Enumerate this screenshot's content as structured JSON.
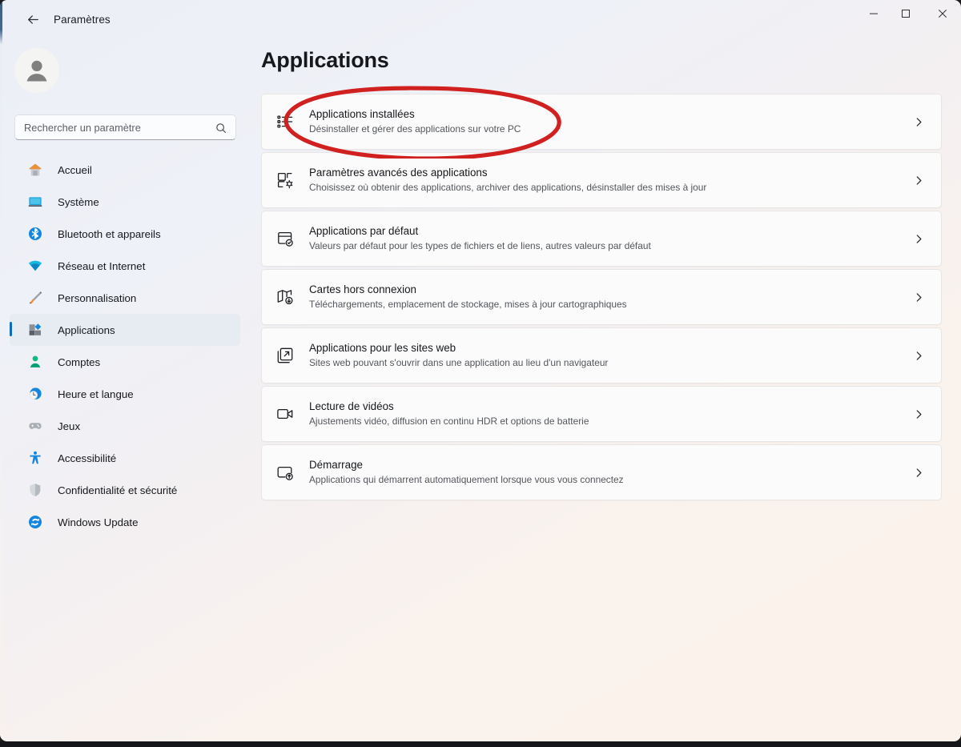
{
  "window": {
    "title": "Paramètres",
    "back_icon": "back-arrow-icon",
    "minimize_label": "—",
    "maximize_label": "□",
    "close_label": "✕"
  },
  "sidebar": {
    "avatar_icon": "user-avatar-icon",
    "search": {
      "placeholder": "Rechercher un paramètre",
      "value": "",
      "icon": "search-icon"
    },
    "items": [
      {
        "label": "Accueil",
        "icon": "home-icon",
        "selected": false
      },
      {
        "label": "Système",
        "icon": "system-icon",
        "selected": false
      },
      {
        "label": "Bluetooth et appareils",
        "icon": "bluetooth-icon",
        "selected": false
      },
      {
        "label": "Réseau et Internet",
        "icon": "network-icon",
        "selected": false
      },
      {
        "label": "Personnalisation",
        "icon": "brush-icon",
        "selected": false
      },
      {
        "label": "Applications",
        "icon": "apps-icon",
        "selected": true
      },
      {
        "label": "Comptes",
        "icon": "accounts-icon",
        "selected": false
      },
      {
        "label": "Heure et langue",
        "icon": "clock-globe-icon",
        "selected": false
      },
      {
        "label": "Jeux",
        "icon": "gamepad-icon",
        "selected": false
      },
      {
        "label": "Accessibilité",
        "icon": "accessibility-icon",
        "selected": false
      },
      {
        "label": "Confidentialité et sécurité",
        "icon": "shield-icon",
        "selected": false
      },
      {
        "label": "Windows Update",
        "icon": "update-icon",
        "selected": false
      }
    ]
  },
  "main": {
    "page_title": "Applications",
    "cards": [
      {
        "title": "Applications installées",
        "subtitle": "Désinstaller et gérer des applications sur votre PC",
        "icon": "installed-apps-list-icon",
        "chevron": "chevron-right-icon",
        "annotated": true
      },
      {
        "title": "Paramètres avancés des applications",
        "subtitle": "Choisissez où obtenir des applications, archiver des applications, désinstaller des mises à jour",
        "icon": "advanced-app-settings-icon",
        "chevron": "chevron-right-icon",
        "annotated": false
      },
      {
        "title": "Applications par défaut",
        "subtitle": "Valeurs par défaut pour les types de fichiers et de liens, autres valeurs par défaut",
        "icon": "default-apps-icon",
        "chevron": "chevron-right-icon",
        "annotated": false
      },
      {
        "title": "Cartes hors connexion",
        "subtitle": "Téléchargements, emplacement de stockage, mises à jour cartographiques",
        "icon": "offline-maps-icon",
        "chevron": "chevron-right-icon",
        "annotated": false
      },
      {
        "title": "Applications pour les sites web",
        "subtitle": "Sites web pouvant s'ouvrir dans une application au lieu d'un navigateur",
        "icon": "apps-for-websites-icon",
        "chevron": "chevron-right-icon",
        "annotated": false
      },
      {
        "title": "Lecture de vidéos",
        "subtitle": "Ajustements vidéo, diffusion en continu HDR et options de batterie",
        "icon": "video-playback-icon",
        "chevron": "chevron-right-icon",
        "annotated": false
      },
      {
        "title": "Démarrage",
        "subtitle": "Applications qui démarrent automatiquement lorsque vous vous connectez",
        "icon": "startup-icon",
        "chevron": "chevron-right-icon",
        "annotated": false
      }
    ]
  },
  "annotation": {
    "shape": "ellipse",
    "color": "#d0201f",
    "target": "Applications installées"
  },
  "colors": {
    "accent": "#0f6cbd",
    "annotation_red": "#d0201f",
    "card_bg": "#fbfbfb",
    "bg_top": "#eef1f7",
    "bg_bottom": "#faf2ec"
  }
}
